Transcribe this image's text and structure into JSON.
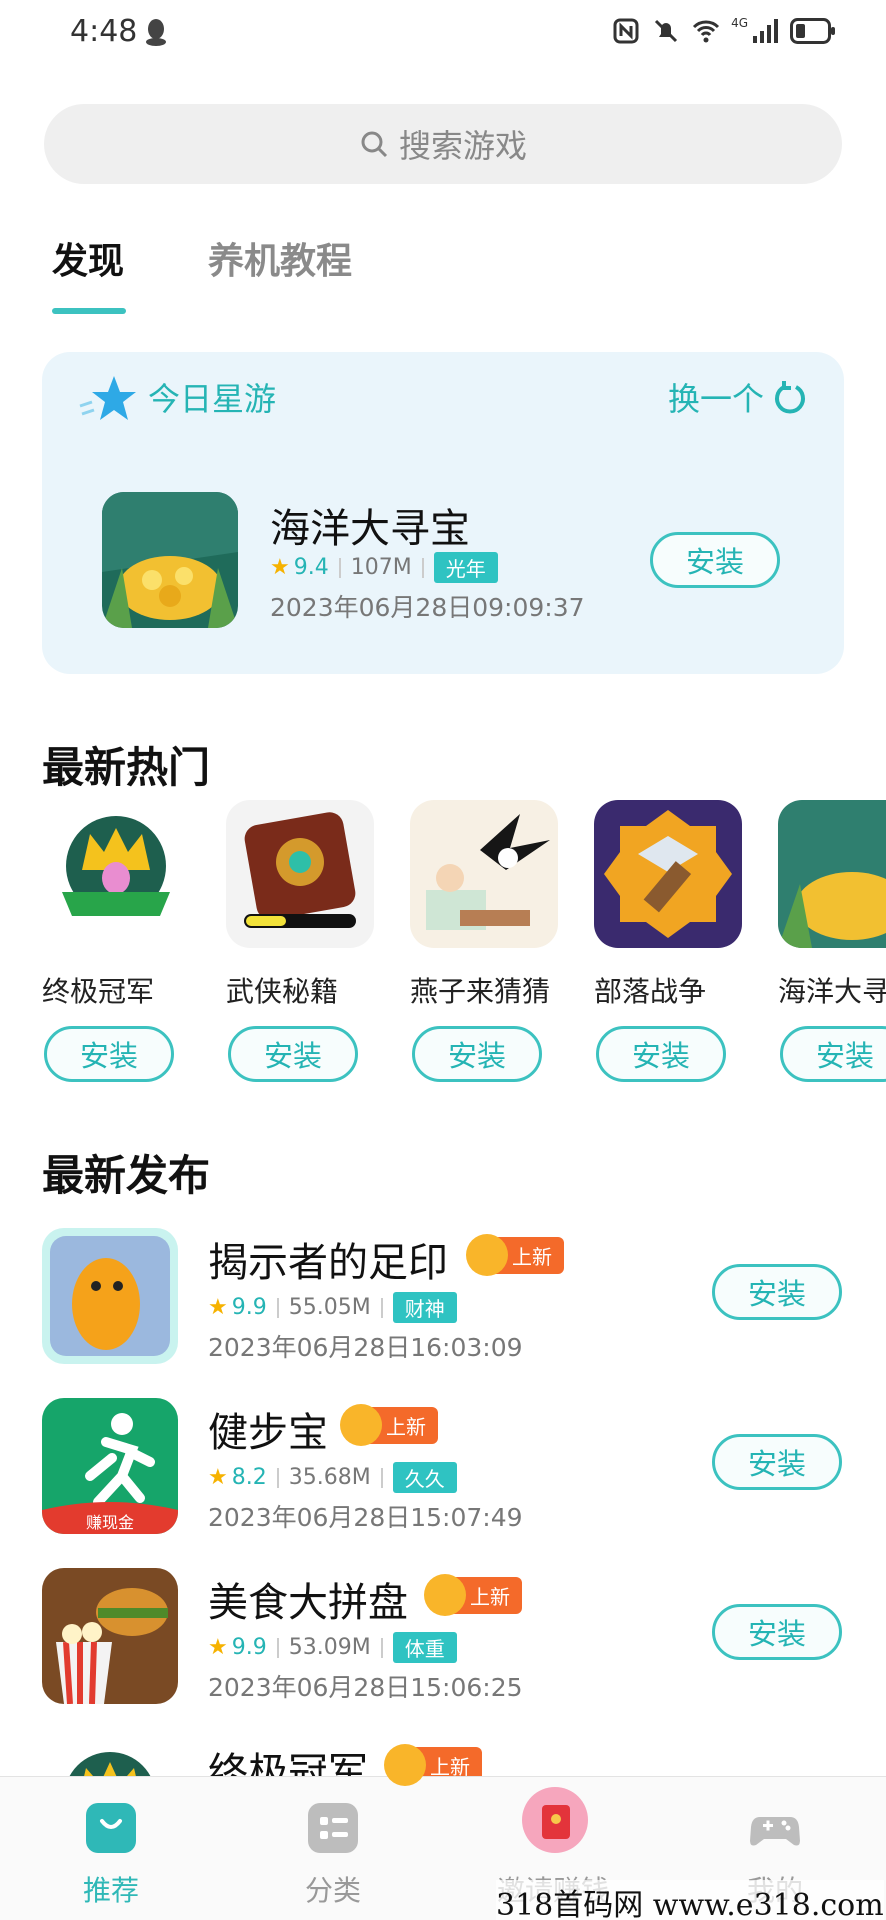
{
  "status": {
    "time": "4:48",
    "network": "4G"
  },
  "search": {
    "placeholder": "搜索游戏"
  },
  "tabs": [
    {
      "label": "发现"
    },
    {
      "label": "养机教程"
    }
  ],
  "today": {
    "title": "今日星游",
    "refresh": "换一个",
    "game": {
      "name": "海洋大寻宝",
      "rating": "9.4",
      "size": "107M",
      "tag": "光年",
      "date": "2023年06月28日09:09:37",
      "install": "安装"
    }
  },
  "hot": {
    "title": "最新热门",
    "items": [
      {
        "name": "终极冠军",
        "install": "安装"
      },
      {
        "name": "武侠秘籍",
        "install": "安装"
      },
      {
        "name": "燕子来猜猜",
        "install": "安装"
      },
      {
        "name": "部落战争",
        "install": "安装"
      },
      {
        "name": "海洋大寻宝",
        "install": "安装"
      }
    ]
  },
  "new": {
    "title": "最新发布",
    "badge": "上新",
    "items": [
      {
        "name": "揭示者的足印",
        "rating": "9.9",
        "size": "55.05M",
        "tag": "财神",
        "date": "2023年06月28日16:03:09",
        "install": "安装"
      },
      {
        "name": "健步宝",
        "rating": "8.2",
        "size": "35.68M",
        "tag": "久久",
        "date": "2023年06月28日15:07:49",
        "install": "安装"
      },
      {
        "name": "美食大拼盘",
        "rating": "9.9",
        "size": "53.09M",
        "tag": "体重",
        "date": "2023年06月28日15:06:25",
        "install": "安装"
      },
      {
        "name": "终极冠军"
      },
      {
        "label": "赚现金"
      }
    ]
  },
  "nav": [
    {
      "label": "推荐"
    },
    {
      "label": "分类"
    },
    {
      "label": "邀请赚钱"
    },
    {
      "label": "我的"
    }
  ],
  "watermark": "318首码网 www.e318.com",
  "colors": {
    "accent": "#3cc2c0",
    "tag": "#2fc3c2",
    "star": "#f6b200",
    "badge": "#f46a2a"
  }
}
